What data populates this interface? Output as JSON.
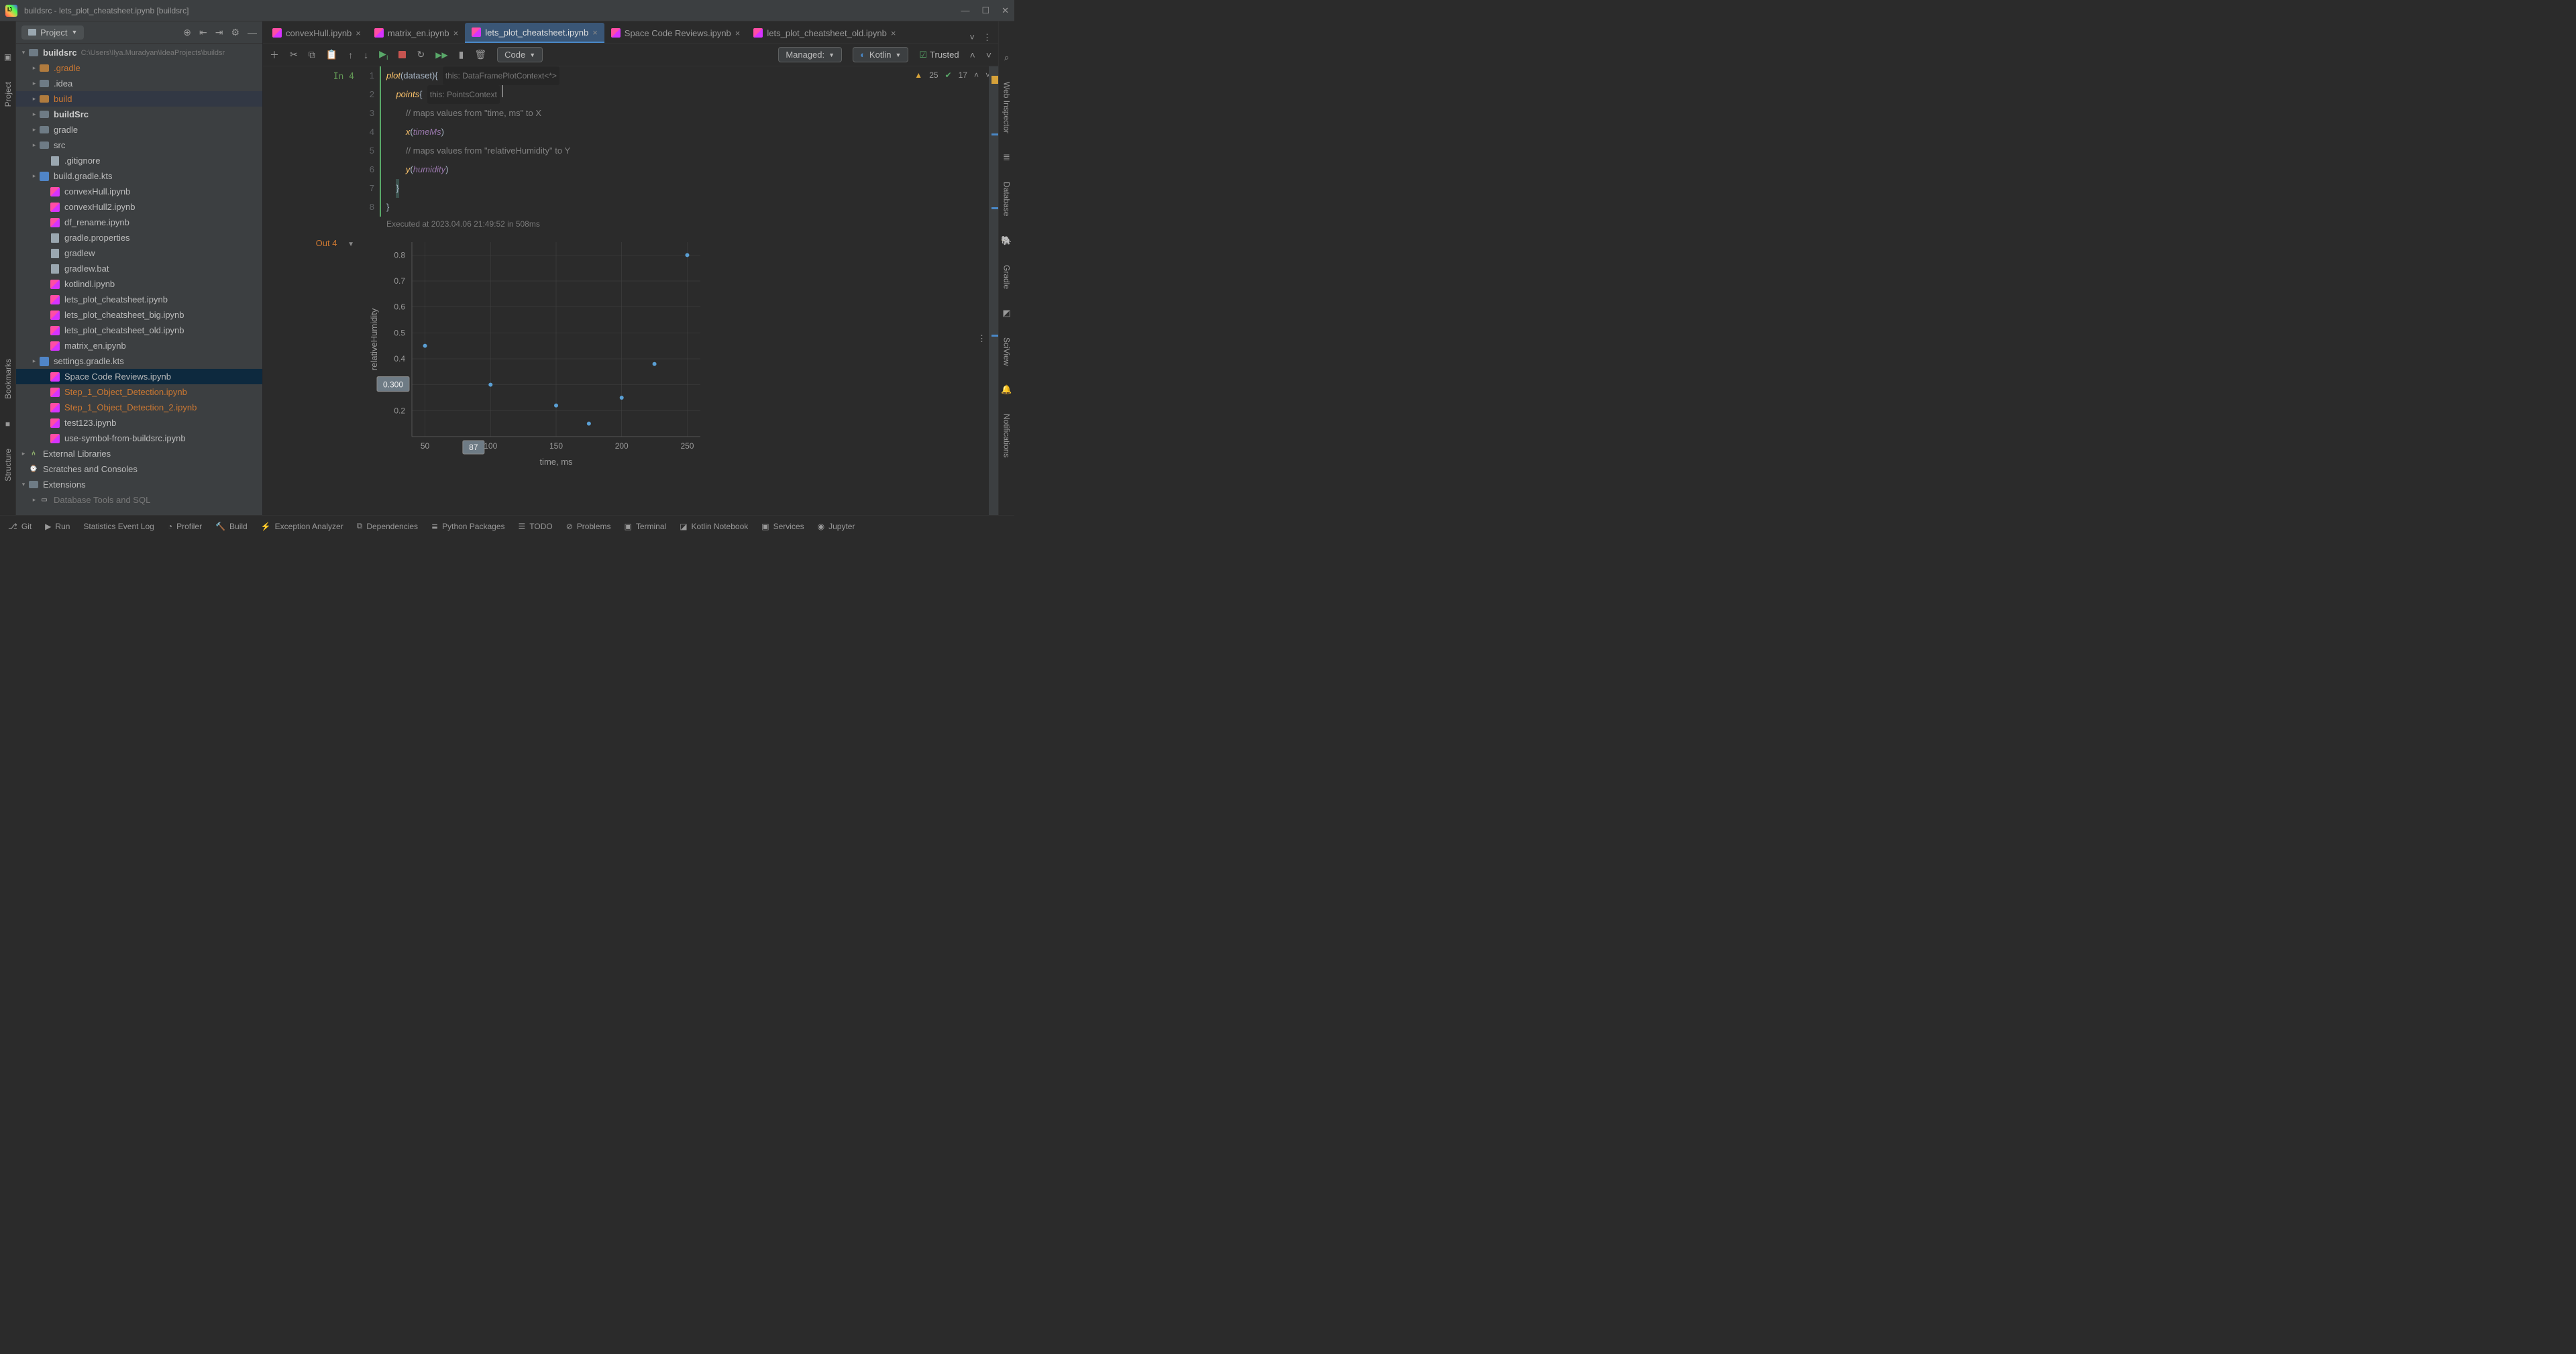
{
  "window": {
    "title": "buildsrc - lets_plot_cheatsheet.ipynb [buildsrc]"
  },
  "leftGutter": {
    "items": [
      "Project",
      "Bookmarks",
      "Structure"
    ]
  },
  "projectPanel": {
    "label": "Project",
    "root": {
      "name": "buildsrc",
      "path": "C:\\Users\\Ilya.Muradyan\\IdeaProjects\\buildsr"
    },
    "tree": [
      {
        "l": ".gradle",
        "ic": "folder-orange",
        "indent": 1,
        "chev": "right",
        "orange": true
      },
      {
        "l": ".idea",
        "ic": "folder",
        "indent": 1,
        "chev": "right"
      },
      {
        "l": "build",
        "ic": "folder-orange",
        "indent": 1,
        "chev": "right",
        "orange": true,
        "selbg": true
      },
      {
        "l": "buildSrc",
        "ic": "folder",
        "indent": 1,
        "chev": "right",
        "bold": true
      },
      {
        "l": "gradle",
        "ic": "folder",
        "indent": 1,
        "chev": "right"
      },
      {
        "l": "src",
        "ic": "folder",
        "indent": 1,
        "chev": "right"
      },
      {
        "l": ".gitignore",
        "ic": "txt",
        "indent": 2
      },
      {
        "l": "build.gradle.kts",
        "ic": "kt",
        "indent": 1,
        "chev": "right"
      },
      {
        "l": "convexHull.ipynb",
        "ic": "nb",
        "indent": 2
      },
      {
        "l": "convexHull2.ipynb",
        "ic": "nb",
        "indent": 2
      },
      {
        "l": "df_rename.ipynb",
        "ic": "nb",
        "indent": 2
      },
      {
        "l": "gradle.properties",
        "ic": "txt",
        "indent": 2
      },
      {
        "l": "gradlew",
        "ic": "txt",
        "indent": 2
      },
      {
        "l": "gradlew.bat",
        "ic": "txt",
        "indent": 2
      },
      {
        "l": "kotlindl.ipynb",
        "ic": "nb",
        "indent": 2
      },
      {
        "l": "lets_plot_cheatsheet.ipynb",
        "ic": "nb",
        "indent": 2
      },
      {
        "l": "lets_plot_cheatsheet_big.ipynb",
        "ic": "nb",
        "indent": 2
      },
      {
        "l": "lets_plot_cheatsheet_old.ipynb",
        "ic": "nb",
        "indent": 2
      },
      {
        "l": "matrix_en.ipynb",
        "ic": "nb",
        "indent": 2
      },
      {
        "l": "settings.gradle.kts",
        "ic": "kt",
        "indent": 1,
        "chev": "right"
      },
      {
        "l": "Space Code Reviews.ipynb",
        "ic": "nb",
        "indent": 2,
        "sel": true
      },
      {
        "l": "Step_1_Object_Detection.ipynb",
        "ic": "nb",
        "indent": 2,
        "orange": true
      },
      {
        "l": "Step_1_Object_Detection_2.ipynb",
        "ic": "nb",
        "indent": 2,
        "orange": true
      },
      {
        "l": "test123.ipynb",
        "ic": "nb",
        "indent": 2
      },
      {
        "l": "use-symbol-from-buildsrc.ipynb",
        "ic": "nb",
        "indent": 2
      }
    ],
    "extras": [
      "External Libraries",
      "Scratches and Consoles",
      "Extensions",
      "Database Tools and SQL"
    ]
  },
  "editorTabs": [
    {
      "label": "convexHull.ipynb"
    },
    {
      "label": "matrix_en.ipynb"
    },
    {
      "label": "lets_plot_cheatsheet.ipynb",
      "active": true
    },
    {
      "label": "Space Code Reviews.ipynb"
    },
    {
      "label": "lets_plot_cheatsheet_old.ipynb"
    }
  ],
  "toolbar": {
    "codeLabel": "Code",
    "managedLabel": "Managed:",
    "kernelLabel": "Kotlin",
    "trustedLabel": "Trusted"
  },
  "inspections": {
    "warnings": "25",
    "ok": "17"
  },
  "cell": {
    "inPrompt": "In 4",
    "outPrompt": "Out 4",
    "lineNos": [
      "1",
      "2",
      "3",
      "4",
      "5",
      "6",
      "7",
      "8"
    ],
    "l1a": "plot",
    "l1b": "(dataset) ",
    "l1c": "{",
    "l1d": "this: DataFramePlotContext<*>",
    "l2a": "points ",
    "l2b": "{",
    "l2c": "this: PointsContext",
    "l3": "// maps values from \"time, ms\" to X",
    "l4a": "x",
    "l4b": "(",
    "l4c": "timeMs",
    "l4d": ")",
    "l5": "// maps values from \"relativeHumidity\" to Y",
    "l6a": "y",
    "l6b": "(",
    "l6c": "humidity",
    "l6d": ")",
    "l7": "}",
    "l8": "}",
    "status": "Executed at 2023.04.06 21:49:52 in 508ms"
  },
  "chart_data": {
    "type": "scatter",
    "xlabel": "time, ms",
    "ylabel": "relativeHumidity",
    "x": [
      50,
      100,
      150,
      175,
      200,
      225,
      250
    ],
    "y": [
      0.45,
      0.3,
      0.22,
      0.15,
      0.25,
      0.38,
      0.8
    ],
    "xticks": [
      50,
      100,
      150,
      200,
      250
    ],
    "yticks": [
      0.2,
      0.3,
      0.4,
      0.5,
      0.6,
      0.7,
      0.8
    ],
    "hover": {
      "x": 87,
      "y": 0.3,
      "xlabel": "87",
      "ylabel": "0.300"
    },
    "xlim": [
      40,
      260
    ],
    "ylim": [
      0.1,
      0.85
    ]
  },
  "rightGutter": {
    "items": [
      "Web Inspector",
      "Database",
      "Gradle",
      "SciView",
      "Notifications"
    ]
  },
  "statusbar": {
    "items": [
      "Git",
      "Run",
      "Statistics Event Log",
      "Profiler",
      "Build",
      "Exception Analyzer",
      "Dependencies",
      "Python Packages",
      "TODO",
      "Problems",
      "Terminal",
      "Kotlin Notebook",
      "Services",
      "Jupyter"
    ]
  }
}
